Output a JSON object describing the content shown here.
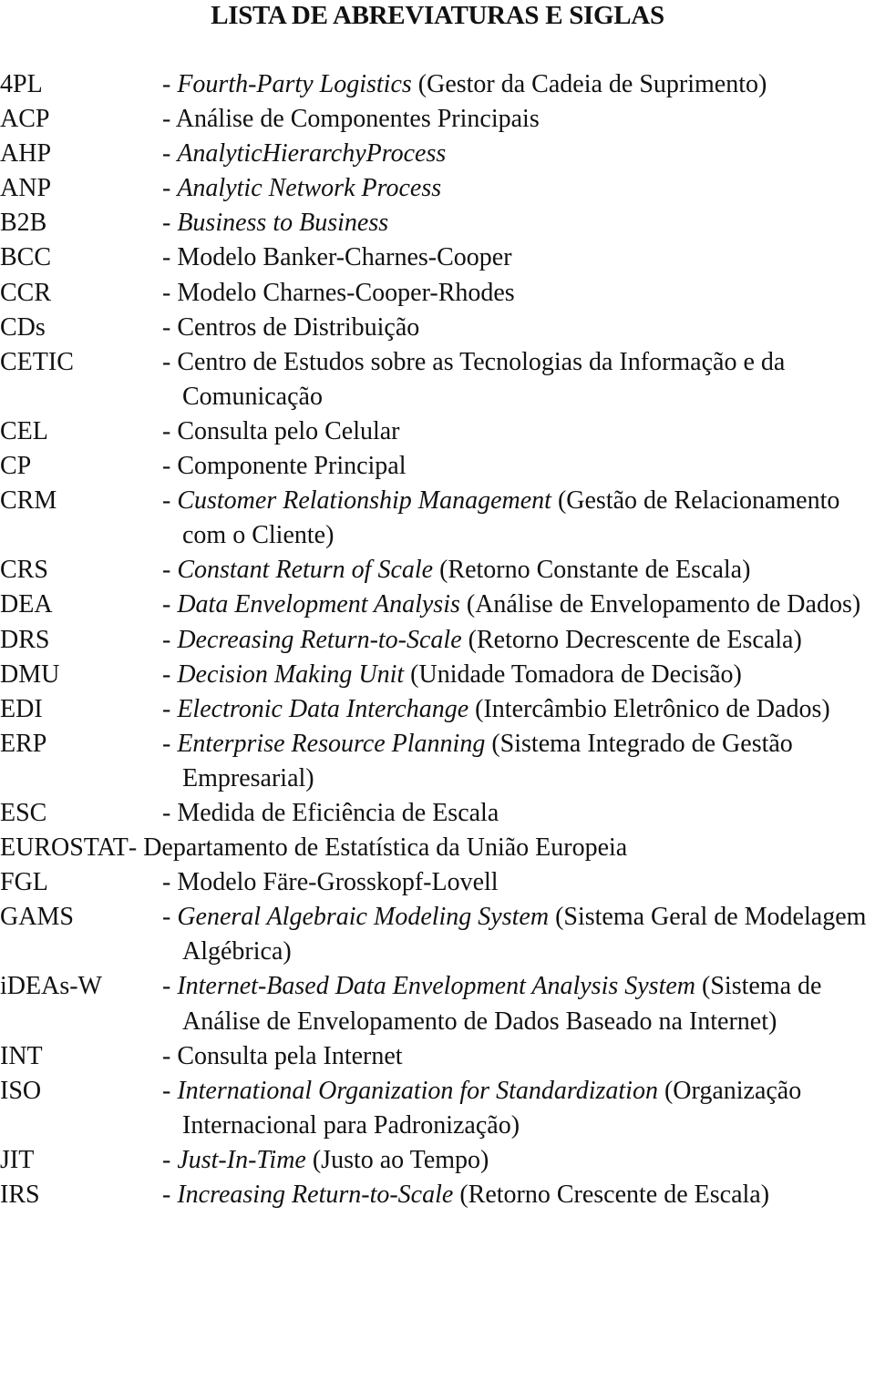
{
  "title": "LISTA DE ABREVIATURAS E SIGLAS",
  "entries": [
    {
      "abbr": "4PL",
      "italic": "Fourth-Party Logistics",
      "text": " (Gestor da Cadeia de Suprimento)"
    },
    {
      "abbr": "ACP",
      "italic": "",
      "text": "Análise de Componentes Principais"
    },
    {
      "abbr": "AHP",
      "italic": "AnalyticHierarchyProcess",
      "text": ""
    },
    {
      "abbr": "ANP",
      "italic": "Analytic Network Process",
      "text": ""
    },
    {
      "abbr": "B2B",
      "italic": "Business to Business",
      "text": ""
    },
    {
      "abbr": "BCC",
      "italic": "",
      "text": "Modelo Banker-Charnes-Cooper"
    },
    {
      "abbr": "CCR",
      "italic": "",
      "text": "Modelo Charnes-Cooper-Rhodes"
    },
    {
      "abbr": "CDs",
      "italic": "",
      "text": "Centros de Distribuição"
    },
    {
      "abbr": "CETIC",
      "italic": "",
      "text": "Centro de Estudos sobre as Tecnologias da Informação e da Comunicação"
    },
    {
      "abbr": "CEL",
      "italic": "",
      "text": "Consulta pelo Celular"
    },
    {
      "abbr": "CP",
      "italic": "",
      "text": "Componente Principal"
    },
    {
      "abbr": "CRM",
      "italic": "Customer Relationship Management",
      "text": " (Gestão de Relacionamento com o Cliente)"
    },
    {
      "abbr": "CRS",
      "italic": "Constant Return of Scale",
      "text": " (Retorno Constante de Escala)"
    },
    {
      "abbr": "DEA",
      "italic": "Data Envelopment Analysis",
      "text": " (Análise de Envelopamento de Dados)"
    },
    {
      "abbr": "DRS",
      "italic": "Decreasing Return-to-Scale",
      "text": " (Retorno Decrescente de Escala)"
    },
    {
      "abbr": "DMU",
      "italic": "Decision Making Unit",
      "text": " (Unidade Tomadora de Decisão)"
    },
    {
      "abbr": "EDI",
      "italic": "Electronic Data Interchange",
      "text": " (Intercâmbio Eletrônico de Dados)"
    },
    {
      "abbr": "ERP",
      "italic": "Enterprise Resource Planning",
      "text": " (Sistema Integrado de Gestão Empresarial)"
    },
    {
      "abbr": "ESC",
      "italic": "",
      "text": "Medida de Eficiência de Escala"
    },
    {
      "abbr": "EUROSTAT",
      "italic": "",
      "text": "Departamento de Estatística da União Europeia",
      "wide": true
    },
    {
      "abbr": "FGL",
      "italic": "",
      "text": "Modelo Färe-Grosskopf-Lovell"
    },
    {
      "abbr": "GAMS",
      "italic": "General Algebraic Modeling System",
      "text": " (Sistema Geral de Modelagem Algébrica)"
    },
    {
      "abbr": "iDEAs-W",
      "italic": "Internet-Based Data Envelopment Analysis System",
      "text": " (Sistema de Análise de Envelopamento de Dados Baseado na Internet)"
    },
    {
      "abbr": "INT",
      "italic": "",
      "text": "Consulta pela Internet"
    },
    {
      "abbr": "ISO",
      "italic": "International Organization for Standardization",
      "text": " (Organização Internacional para Padronização)"
    },
    {
      "abbr": "JIT",
      "italic": "Just-In-Time",
      "text": " (Justo ao Tempo)"
    },
    {
      "abbr": "IRS",
      "italic": "Increasing Return-to-Scale",
      "text": " (Retorno Crescente de Escala)"
    }
  ],
  "dash": "- "
}
